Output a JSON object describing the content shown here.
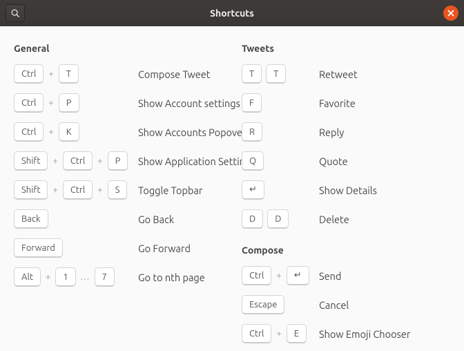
{
  "window": {
    "title": "Shortcuts"
  },
  "icons": {
    "search": "search-icon",
    "close": "close-icon"
  },
  "left": {
    "general": {
      "title": "General",
      "rows": [
        {
          "k1": "Ctrl",
          "p1": "+",
          "k2": "T",
          "desc": "Compose Tweet"
        },
        {
          "k1": "Ctrl",
          "p1": "+",
          "k2": "P",
          "desc": "Show Account settings"
        },
        {
          "k1": "Ctrl",
          "p1": "+",
          "k2": "K",
          "desc": "Show Accounts Popover"
        },
        {
          "k1": "Shift",
          "p1": "+",
          "k2": "Ctrl",
          "p2": "+",
          "k3": "P",
          "desc": "Show Application Settings"
        },
        {
          "k1": "Shift",
          "p1": "+",
          "k2": "Ctrl",
          "p2": "+",
          "k3": "S",
          "desc": "Toggle Topbar"
        },
        {
          "k1": "Back",
          "desc": "Go Back"
        },
        {
          "k1": "Forward",
          "desc": "Go Forward"
        },
        {
          "k1": "Alt",
          "p1": "+",
          "k2": "1",
          "dots": "…",
          "k3": "7",
          "desc": "Go to nth page"
        }
      ]
    }
  },
  "right": {
    "tweets": {
      "title": "Tweets",
      "rows": [
        {
          "k1": "T",
          "k2": "T",
          "desc": "Retweet"
        },
        {
          "k1": "F",
          "desc": "Favorite"
        },
        {
          "k1": "R",
          "desc": "Reply"
        },
        {
          "k1": "Q",
          "desc": "Quote"
        },
        {
          "k1": "↵",
          "desc": "Show Details"
        },
        {
          "k1": "D",
          "k2": "D",
          "desc": "Delete"
        }
      ]
    },
    "compose": {
      "title": "Compose",
      "rows": [
        {
          "k1": "Ctrl",
          "p1": "+",
          "k2": "↵",
          "desc": "Send"
        },
        {
          "k1": "Escape",
          "desc": "Cancel"
        },
        {
          "k1": "Ctrl",
          "p1": "+",
          "k2": "E",
          "desc": "Show Emoji Chooser"
        }
      ]
    }
  }
}
